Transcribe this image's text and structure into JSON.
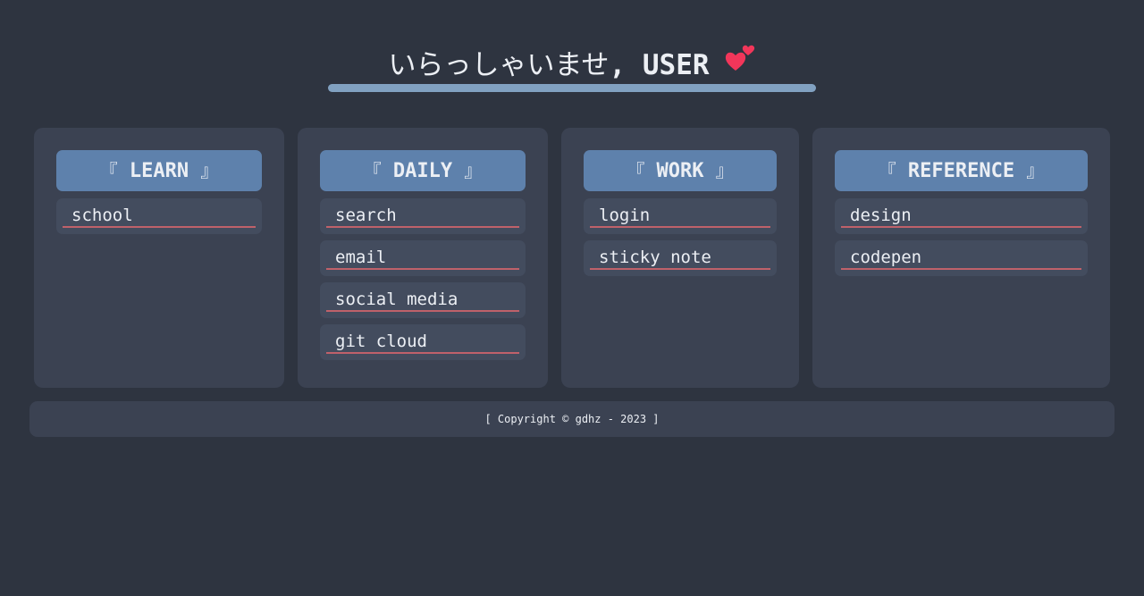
{
  "header": {
    "greeting_jp": "いらっしゃいませ",
    "separator": ",",
    "user": "USER",
    "icon": "two-hearts-icon",
    "accent_color": "#81a1c1",
    "heart_color": "#f2365a"
  },
  "cards": [
    {
      "title": "LEARN",
      "bracket_open": "『",
      "bracket_close": "』",
      "links": [
        "school"
      ]
    },
    {
      "title": "DAILY",
      "bracket_open": "『",
      "bracket_close": "』",
      "links": [
        "search",
        "email",
        "social media",
        "git cloud"
      ]
    },
    {
      "title": "WORK",
      "bracket_open": "『",
      "bracket_close": "』",
      "links": [
        "login",
        "sticky note"
      ]
    },
    {
      "title": "REFERENCE",
      "bracket_open": "『",
      "bracket_close": "』",
      "links": [
        "design",
        "codepen"
      ]
    }
  ],
  "footer": {
    "text": "[ Copyright © gdhz - 2023 ]"
  },
  "colors": {
    "background": "#2e3440",
    "card": "#3b4252",
    "card_title": "#5e81ac",
    "link_bg": "#434c5e",
    "link_underline": "#bf616a",
    "text": "#eceff4"
  }
}
